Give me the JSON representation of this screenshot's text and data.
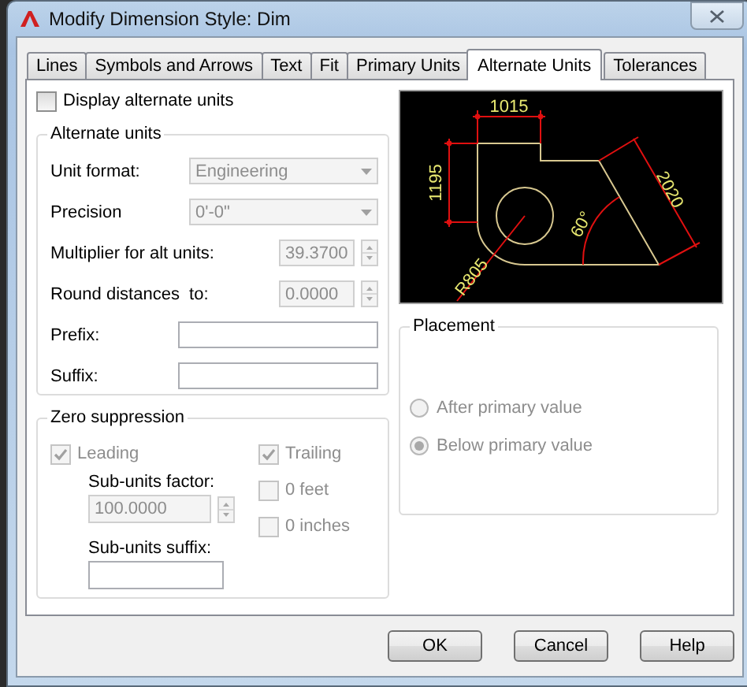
{
  "window": {
    "title": "Modify Dimension Style: Dim"
  },
  "tabs": [
    {
      "label": "Lines",
      "selected": false
    },
    {
      "label": "Symbols and Arrows",
      "selected": false
    },
    {
      "label": "Text",
      "selected": false
    },
    {
      "label": "Fit",
      "selected": false
    },
    {
      "label": "Primary Units",
      "selected": false
    },
    {
      "label": "Alternate Units",
      "selected": true
    },
    {
      "label": "Tolerances",
      "selected": false
    }
  ],
  "display_alternate_units": {
    "label": "Display alternate units",
    "checked": false
  },
  "alternate_units": {
    "title": "Alternate units",
    "fields": [
      {
        "kind": "dropdown",
        "label": "Unit format:",
        "value": "Engineering",
        "disabled": true
      },
      {
        "kind": "dropdown",
        "label": "Precision",
        "value": "0'-0\"",
        "disabled": true
      },
      {
        "kind": "spinner",
        "label": "Multiplier for alt units:",
        "value": "39.3700",
        "disabled": true
      },
      {
        "kind": "spinner",
        "label": "Round distances  to:",
        "value": "0.0000",
        "disabled": true
      },
      {
        "kind": "text",
        "label": "Prefix:",
        "disabled": false
      },
      {
        "kind": "text",
        "label": "Suffix:",
        "disabled": false
      }
    ]
  },
  "zero_suppression": {
    "title": "Zero suppression",
    "options": [
      {
        "label": "Leading",
        "checked": true,
        "disabled": true
      },
      {
        "label": "Trailing",
        "checked": true,
        "disabled": true
      },
      {
        "label": "0 feet",
        "checked": false,
        "disabled": true
      },
      {
        "label": "0 inches",
        "checked": false,
        "disabled": true
      }
    ],
    "sub_units_factor": {
      "label": "Sub-units factor:",
      "value": "100.0000",
      "disabled": true
    },
    "sub_units_suffix": {
      "label": "Sub-units suffix:"
    }
  },
  "preview": {
    "labels": [
      "1015",
      "1195",
      "2020",
      "60°",
      "R805"
    ]
  },
  "placement": {
    "title": "Placement",
    "options": [
      {
        "label": "After primary value",
        "selected": false,
        "disabled": true
      },
      {
        "label": "Below primary value",
        "selected": true,
        "disabled": true
      }
    ]
  },
  "buttons": [
    "OK",
    "Cancel",
    "Help"
  ]
}
